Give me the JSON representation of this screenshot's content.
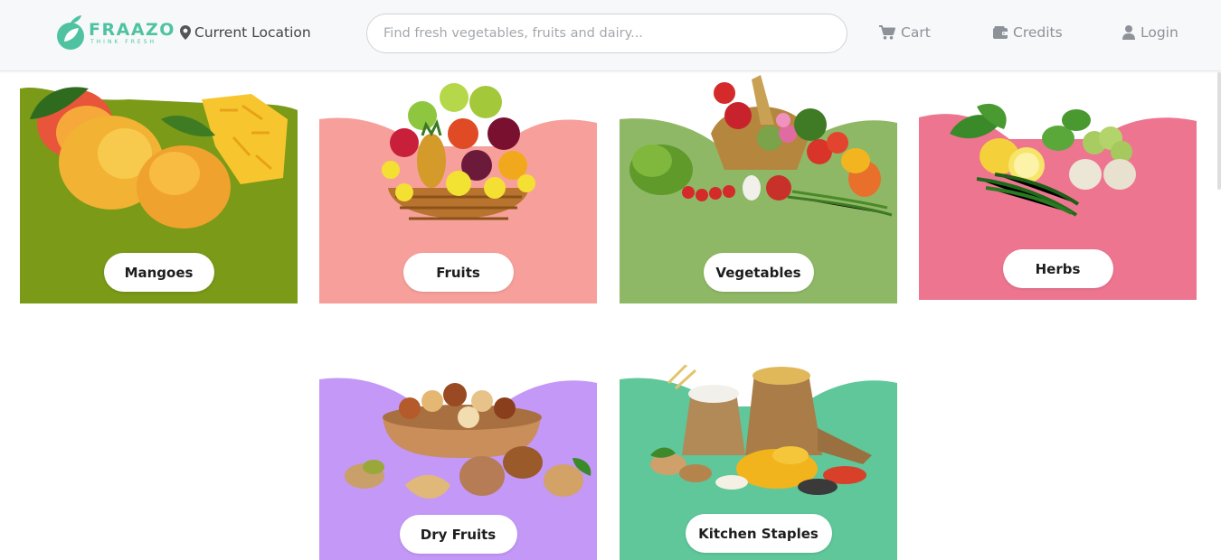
{
  "header": {
    "logo_name": "FRAAZO",
    "logo_tagline": "THINK FRESH",
    "location_label": "Current Location",
    "search_placeholder": "Find fresh vegetables, fruits and dairy...",
    "nav": {
      "cart": "Cart",
      "credits": "Credits",
      "login": "Login"
    }
  },
  "colors": {
    "brand": "#4fc3a1",
    "mangoes": "#7a9a18",
    "fruits": "#f7a09b",
    "vegetables": "#8fb866",
    "herbs": "#ee7590",
    "dry_fruits": "#c398f7",
    "kitchen_staples": "#5fc79a"
  },
  "categories": [
    {
      "label": "Mangoes",
      "icon": "mango-image"
    },
    {
      "label": "Fruits",
      "icon": "fruit-basket-image"
    },
    {
      "label": "Vegetables",
      "icon": "vegetables-image"
    },
    {
      "label": "Herbs",
      "icon": "herbs-image"
    },
    {
      "label": "Dry Fruits",
      "icon": "dry-fruits-image"
    },
    {
      "label": "Kitchen Staples",
      "icon": "kitchen-staples-image"
    }
  ]
}
